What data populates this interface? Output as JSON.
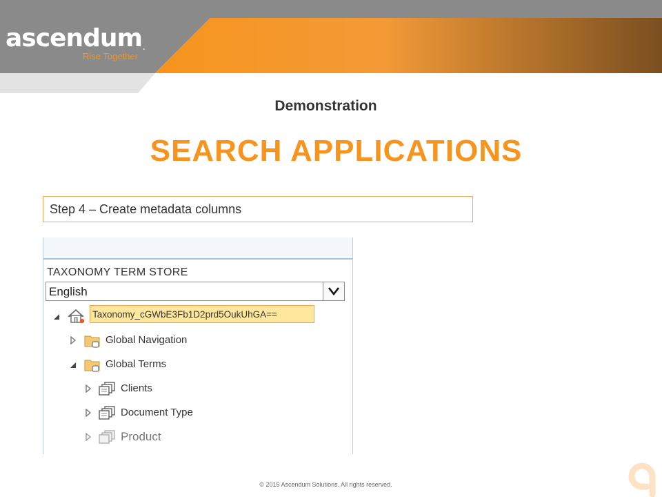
{
  "brand": {
    "name": "ascendum",
    "trademark": ".",
    "tagline": "Rise Together",
    "accent_color": "#f7941d",
    "header_gray": "#8a8a8a",
    "header_brown": "#7a4f20"
  },
  "slide": {
    "subtitle": "Demonstration",
    "title": "SEARCH APPLICATIONS",
    "step": "Step 4 – Create metadata columns"
  },
  "term_store": {
    "label": "TAXONOMY TERM STORE",
    "language": "English",
    "root": {
      "name": "Taxonomy_cGWbE3Fb1D2prd5OukUhGA==",
      "icon": "home-icon",
      "expanded": true
    },
    "groups": [
      {
        "label": "Global Navigation",
        "icon": "folder-tag-icon",
        "expanded": false
      },
      {
        "label": "Global Terms",
        "icon": "folder-tag-icon",
        "expanded": true
      }
    ],
    "term_sets": [
      {
        "label": "Clients",
        "icon": "term-set-icon"
      },
      {
        "label": "Document Type",
        "icon": "term-set-icon"
      },
      {
        "label": "Product",
        "icon": "term-set-faded-icon"
      }
    ]
  },
  "footer": {
    "copyright": "© 2015 Ascendum Solutions. All rights reserved."
  }
}
